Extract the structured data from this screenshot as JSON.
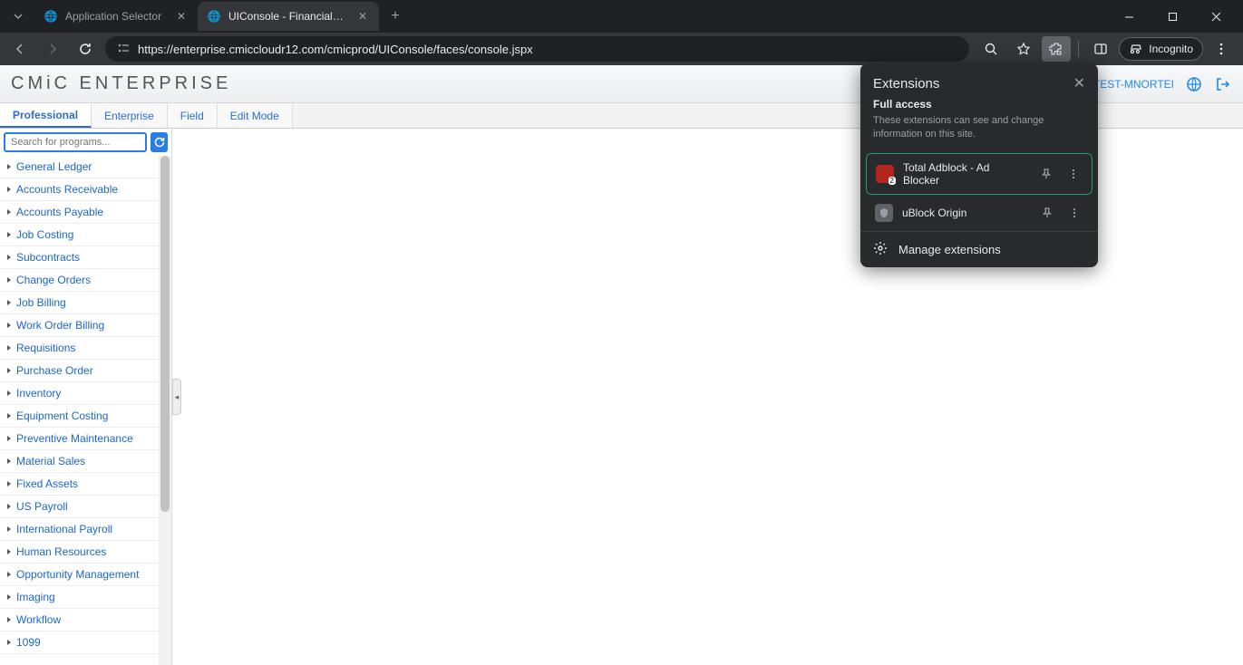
{
  "browser": {
    "tabs": [
      {
        "title": "Application Selector",
        "active": false
      },
      {
        "title": "UIConsole - Financials Console",
        "active": true
      }
    ],
    "url": "https://enterprise.cmiccloudr12.com/cmicprod/UIConsole/faces/console.jspx",
    "incognito_label": "Incognito"
  },
  "extensions_popup": {
    "title": "Extensions",
    "section_title": "Full access",
    "section_desc": "These extensions can see and change information on this site.",
    "items": [
      {
        "name": "Total Adblock - Ad Blocker",
        "badge": "2",
        "highlighted": true
      },
      {
        "name": "uBlock Origin",
        "highlighted": false
      }
    ],
    "manage_label": "Manage extensions"
  },
  "app": {
    "logo": "CMiC ENTERPRISE",
    "user_label": "COMTEST-MNORTEI",
    "mode_tabs": [
      "Professional",
      "Enterprise",
      "Field",
      "Edit Mode"
    ],
    "active_mode": "Professional",
    "search_placeholder": "Search for programs...",
    "tree": [
      "General Ledger",
      "Accounts Receivable",
      "Accounts Payable",
      "Job Costing",
      "Subcontracts",
      "Change Orders",
      "Job Billing",
      "Work Order Billing",
      "Requisitions",
      "Purchase Order",
      "Inventory",
      "Equipment Costing",
      "Preventive Maintenance",
      "Material Sales",
      "Fixed Assets",
      "US Payroll",
      "International Payroll",
      "Human Resources",
      "Opportunity Management",
      "Imaging",
      "Workflow",
      "1099"
    ]
  }
}
